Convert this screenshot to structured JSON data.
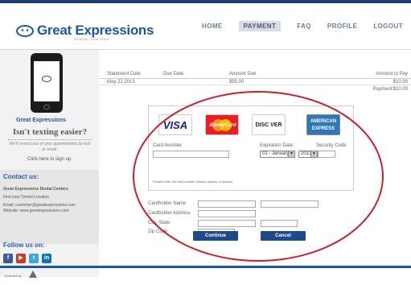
{
  "brand": {
    "name": "Great Expressions",
    "subtitle": "DENTAL CENTERS"
  },
  "nav": [
    "HOME",
    "PAYMENT",
    "FAQ",
    "PROFILE",
    "LOGOUT"
  ],
  "sidebar": {
    "logo": "Great Expressions",
    "heading": "Isn't texting easier?",
    "text": "We'll remind you of your appointments by text or email.",
    "signup": "Click here to sign up.",
    "contact_title": "Contact us:",
    "contact_name": "Great Expressions Dental Centers",
    "contact_line": "Find your Dental Location",
    "contact_email": "Email: customer@greatexpressions.com",
    "contact_web": "Website: www.greatexpressions.com",
    "follow": "Follow us on:"
  },
  "statement": {
    "headers": [
      "Statement Date",
      "Due Date",
      "Amount Due",
      "Amount to Pay"
    ],
    "row": {
      "date": "May 22 2013",
      "amount": "$55.00",
      "to_pay": "$10.00"
    },
    "payment_label": "Payment:",
    "payment_value": "$10.00"
  },
  "cards": {
    "visa": "VISA",
    "mastercard": "MasterCard",
    "discover": "DISC VER",
    "amex": "AMERICAN EXPRESS"
  },
  "form": {
    "card_number": "Card Number",
    "expiration": "Expiration Date:",
    "security": "Security Code",
    "month": "01 - January",
    "year": "2013",
    "hint": "Please enter the card number without spaces or dashes.",
    "holder_name": "Cardholder Name",
    "holder_address": "Cardholder Address",
    "city_state": "City, State",
    "zip": "Zip Code"
  },
  "buttons": {
    "continue": "Continue",
    "cancel": "Cancel"
  },
  "footer": {
    "powered": "powered by"
  },
  "colors": {
    "brand": "#1e56a0",
    "highlight": "#cc1f2a"
  }
}
